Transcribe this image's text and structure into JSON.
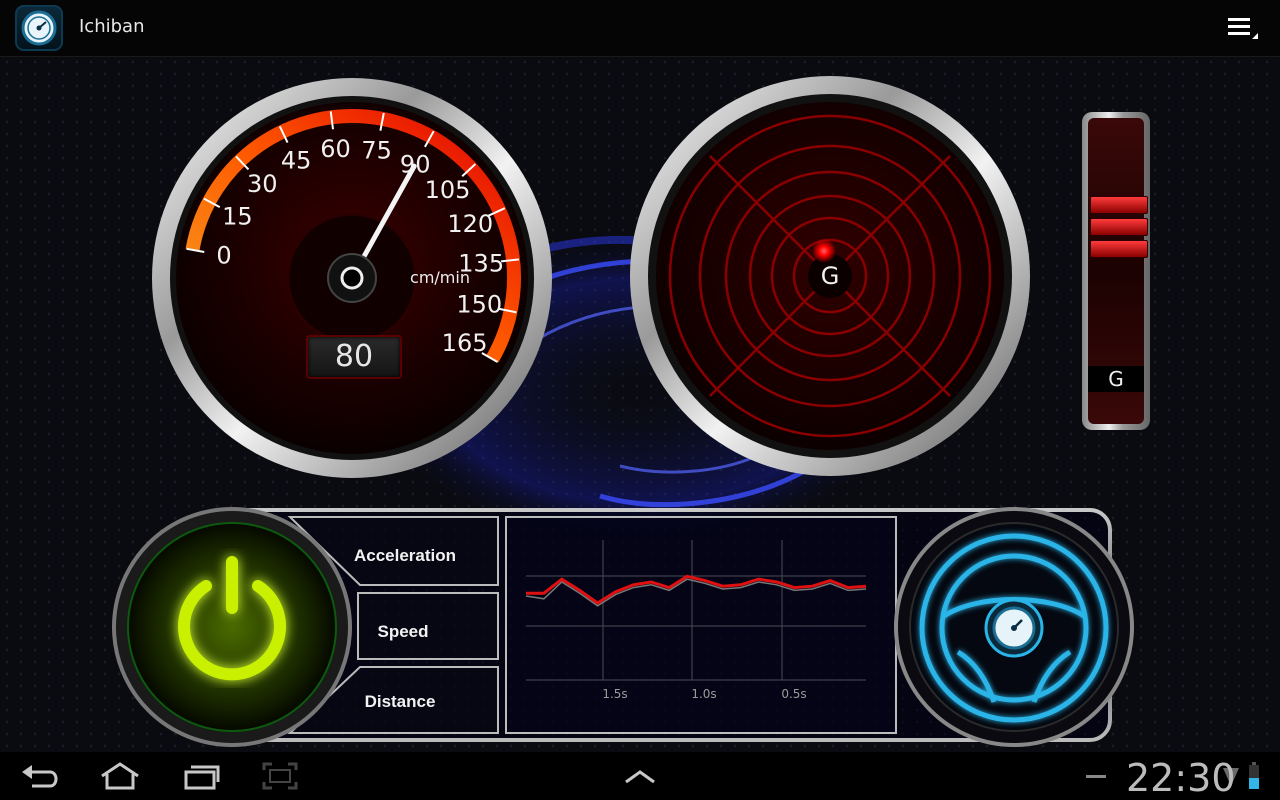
{
  "actionbar": {
    "title": "Ichiban",
    "app_icon": "speedometer-icon",
    "menu_icon": "overflow-menu-icon"
  },
  "speed_gauge": {
    "unit": "cm/min",
    "ticks": [
      "0",
      "15",
      "30",
      "45",
      "60",
      "75",
      "90",
      "105",
      "120",
      "135",
      "150",
      "165"
    ],
    "readout": "80",
    "needle_value": 90,
    "max": 165
  },
  "g_gauge": {
    "label": "G"
  },
  "g_meter": {
    "label": "G",
    "active_bars": 3
  },
  "bottom_panel": {
    "power_icon": "power-icon",
    "buttons": {
      "acceleration": "Acceleration",
      "speed": "Speed",
      "distance": "Distance"
    },
    "steering_icon": "steering-wheel-icon"
  },
  "chart_data": {
    "type": "line",
    "x_tick_labels": [
      "1.5s",
      "1.0s",
      "0.5s"
    ],
    "series": [
      {
        "color": "#e01010",
        "values": [
          0.62,
          0.62,
          0.72,
          0.64,
          0.55,
          0.63,
          0.68,
          0.7,
          0.66,
          0.74,
          0.71,
          0.67,
          0.68,
          0.72,
          0.7,
          0.66,
          0.67,
          0.71,
          0.66,
          0.67
        ]
      },
      {
        "color": "#777777",
        "values": [
          0.6,
          0.58,
          0.7,
          0.62,
          0.53,
          0.61,
          0.66,
          0.68,
          0.64,
          0.72,
          0.69,
          0.65,
          0.66,
          0.7,
          0.68,
          0.64,
          0.65,
          0.69,
          0.64,
          0.65
        ]
      }
    ],
    "grid": true
  },
  "navbar": {
    "back_icon": "back-icon",
    "home_icon": "home-icon",
    "recents_icon": "recent-apps-icon",
    "screenshot_icon": "screenshot-icon",
    "up_icon": "chevron-up-icon",
    "time": "22:30",
    "wifi_icon": "wifi-icon",
    "battery_icon": "battery-icon"
  }
}
